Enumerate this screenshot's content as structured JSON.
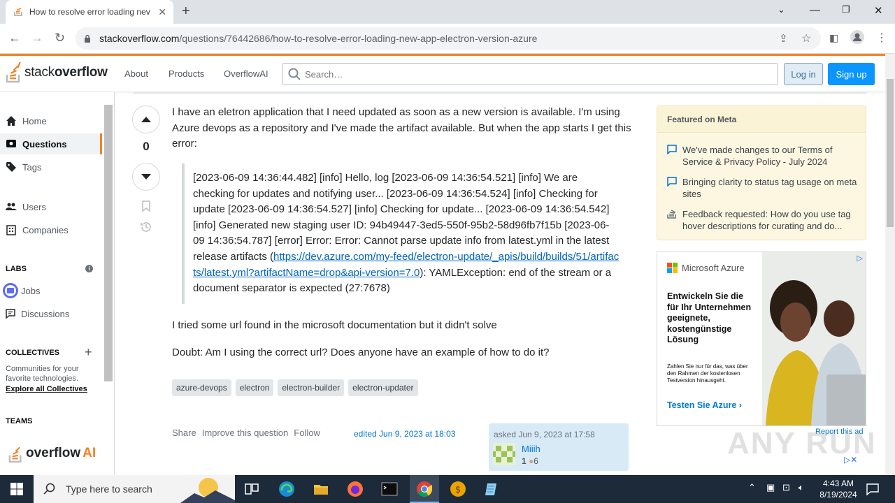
{
  "browser": {
    "tab_title": "How to resolve error loading nev",
    "url_host": "stackoverflow.com",
    "url_path": "/questions/76442686/how-to-resolve-error-loading-new-app-electron-version-azure"
  },
  "header": {
    "logo_text_1": "stack",
    "logo_text_2": "overflow",
    "nav": [
      "About",
      "Products",
      "OverflowAI"
    ],
    "search_placeholder": "Search…",
    "login": "Log in",
    "signup": "Sign up"
  },
  "sidebar": {
    "home": "Home",
    "questions": "Questions",
    "tags": "Tags",
    "users": "Users",
    "companies": "Companies",
    "labs_heading": "LABS",
    "jobs": "Jobs",
    "discussions": "Discussions",
    "collectives_heading": "COLLECTIVES",
    "collectives_desc": "Communities for your favorite technologies.",
    "collectives_link": "Explore all Collectives",
    "teams_heading": "TEAMS",
    "teams_logo_1": "overflow",
    "teams_logo_2": "AI"
  },
  "question": {
    "votes": "0",
    "para1": "I have an eletron application that I need updated as soon as a new version is available. I'm using Azure devops as a repository and I've made the artifact available. But when the app starts I get this error:",
    "log_text": "[2023-06-09 14:36:44.482] [info] Hello, log [2023-06-09 14:36:54.521] [info] We are checking for updates and notifying user... [2023-06-09 14:36:54.524] [info] Checking for update [2023-06-09 14:36:54.527] [info] Checking for update... [2023-06-09 14:36:54.542] [info] Generated new staging user ID: 94b49447-3ed5-550f-95b2-58d96fb7f15b [2023-06-09 14:36:54.787] [error] Error: Error: Cannot parse update info from latest.yml in the latest release artifacts (",
    "log_link": "https://dev.azure.com/my-feed/electron-update/_apis/build/builds/51/artifacts/latest.yml?artifactName=drop&api-version=7.0",
    "log_tail": "): YAMLException: end of the stream or a document separator is expected (27:7678)",
    "para2": "I tried some url found in the microsoft documentation but it didn't solve",
    "para3": "Doubt: Am I using the correct url? Does anyone have an example of how to do it?",
    "tags": [
      "azure-devops",
      "electron",
      "electron-builder",
      "electron-updater"
    ],
    "menu": [
      "Share",
      "Improve this question",
      "Follow"
    ],
    "edited": "edited Jun 9, 2023 at 18:03",
    "asked": "asked Jun 9, 2023 at 17:58",
    "user_name": "Miiih",
    "user_rep": "1",
    "user_bronze": "6"
  },
  "meta": {
    "heading": "Featured on Meta",
    "items": [
      "We've made changes to our Terms of Service & Privacy Policy - July 2024",
      "Bringing clarity to status tag usage on meta sites",
      "Feedback requested: How do you use tag hover descriptions for curating and do..."
    ]
  },
  "ad": {
    "brand": "Microsoft Azure",
    "headline": "Entwickeln Sie die für Ihr Unternehmen geeignete, kostengünstige Lösung",
    "fine": "Zahlen Sie nur für das, was über den Rahmen der kostenlosen Testversion hinausgeht.",
    "cta": "Testen Sie Azure ›",
    "report": "Report this ad"
  },
  "taskbar": {
    "search_placeholder": "Type here to search",
    "time": "4:43 AM",
    "date": "8/19/2024"
  },
  "watermark": "ANY RUN",
  "colors": {
    "accent": "#f48225",
    "primary_button": "#0a95ff",
    "link": "#0063bf"
  }
}
